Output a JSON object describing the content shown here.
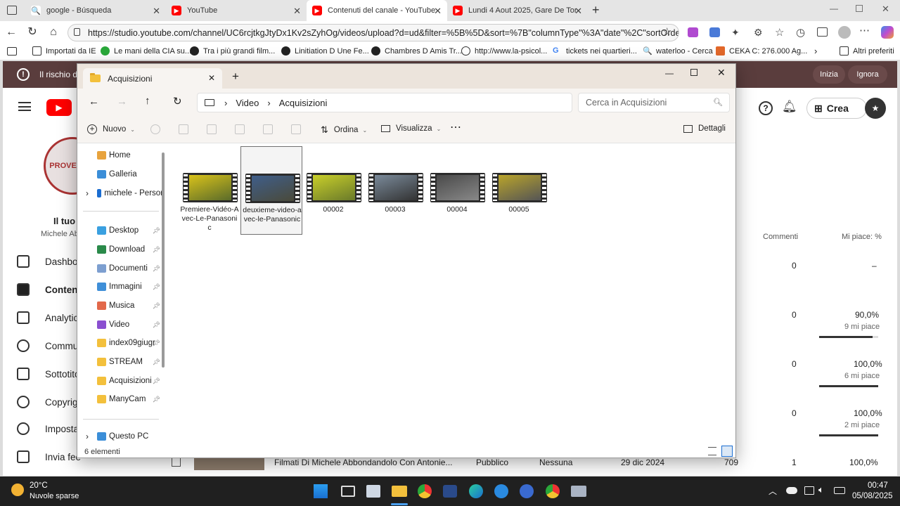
{
  "tabs": [
    {
      "label": "google - Búsqueda",
      "color": "#4285f4"
    },
    {
      "label": "YouTube",
      "color": "#ff0000"
    },
    {
      "label": "Contenuti del canale - YouTube St",
      "color": "#ff0000"
    },
    {
      "label": "Lundi 4 Aout 2025, Gare De Torin",
      "color": "#ff0000"
    }
  ],
  "url": "https://studio.youtube.com/channel/UC6rcjtkgJtyDx1Kv2sZyhOg/videos/upload?d=ud&filter=%5B%5D&sort=%7B\"columnType\"%3A\"date\"%2C\"sortOrder\"...",
  "favorites": [
    "Importati da IE",
    "Le mani della CIA su...",
    "Tra i più grandi film...",
    "Linitiation D Une Fe...",
    "Chambres D Amis Tr...",
    "http://www.la-psicol...",
    "tickets nei quartieri...",
    "waterloo - Cerca",
    "CEKA C: 276.000 Ag...",
    "Altri preferiti"
  ],
  "yt": {
    "warning": "Il rischio di",
    "inizia": "Inizia",
    "ignora": "Ignora",
    "crea": "Crea",
    "channel_title": "Il tuo c",
    "channel_sub": "Michele Ab",
    "nav": [
      "Dashbo",
      "Contenu",
      "Analytic",
      "Commu",
      "Sottotito",
      "Copyrigh",
      "Imposta",
      "Invia fee"
    ],
    "col_comments": "Commenti",
    "col_likes": "Mi piace: %",
    "rows": [
      {
        "comments": "0",
        "likes": "–",
        "sub": ""
      },
      {
        "comments": "0",
        "likes": "90,0%",
        "sub": "9 mi piace"
      },
      {
        "comments": "0",
        "likes": "100,0%",
        "sub": "6 mi piace"
      },
      {
        "comments": "0",
        "likes": "100,0%",
        "sub": "2 mi piace"
      }
    ],
    "bottom_row": {
      "title": "Filmati Di Michele Abbondandolo Con Antonie...",
      "visibility": "Pubblico",
      "restr": "Nessuna",
      "date": "29 dic 2024",
      "views": "709",
      "comments": "1",
      "likes": "100,0%"
    }
  },
  "explorer": {
    "tab": "Acquisizioni",
    "crumbs": [
      "Video",
      "Acquisizioni"
    ],
    "search_placeholder": "Cerca in Acquisizioni",
    "new": "Nuovo",
    "sort": "Ordina",
    "view": "Visualizza",
    "details": "Dettagli",
    "side": [
      {
        "label": "Home",
        "color": "#e8a33d",
        "pin": false
      },
      {
        "label": "Galleria",
        "color": "#3b8ed8",
        "pin": false
      },
      {
        "label": "michele - Persor",
        "color": "#1b6dd1",
        "pin": false
      },
      {
        "label": "Desktop",
        "color": "#3aa0e0",
        "pin": true
      },
      {
        "label": "Download",
        "color": "#2a8a4a",
        "pin": true
      },
      {
        "label": "Documenti",
        "color": "#7d9fd0",
        "pin": true
      },
      {
        "label": "Immagini",
        "color": "#3f8fd8",
        "pin": true
      },
      {
        "label": "Musica",
        "color": "#e2684a",
        "pin": true
      },
      {
        "label": "Video",
        "color": "#8a4fd0",
        "pin": true
      },
      {
        "label": "index09giugr",
        "color": "#f3c03c",
        "pin": true
      },
      {
        "label": "STREAM",
        "color": "#f3c03c",
        "pin": true
      },
      {
        "label": "Acquisizioni",
        "color": "#f3c03c",
        "pin": true
      },
      {
        "label": "ManyCam",
        "color": "#f3c03c",
        "pin": true
      },
      {
        "label": "Questo PC",
        "color": "#3b8ed8",
        "pin": false
      }
    ],
    "files": [
      {
        "name": "Premiere-Vidéo-Avec-Le-Panasonic",
        "c1": "#d9c21a",
        "c2": "#5a6b2a"
      },
      {
        "name": "deuxieme-video-avec-le-Panasonic",
        "c1": "#3f5e8a",
        "c2": "#4a4a3a"
      },
      {
        "name": "00002",
        "c1": "#c9cf2a",
        "c2": "#6a7a2a"
      },
      {
        "name": "00003",
        "c1": "#7a8a9a",
        "c2": "#333"
      },
      {
        "name": "00004",
        "c1": "#4a4a4a",
        "c2": "#888"
      },
      {
        "name": "00005",
        "c1": "#b9a42a",
        "c2": "#555"
      }
    ],
    "status": "6 elementi"
  },
  "taskbar": {
    "temp": "20°C",
    "weather": "Nuvole sparse",
    "time": "00:47",
    "date": "05/08/2025"
  }
}
